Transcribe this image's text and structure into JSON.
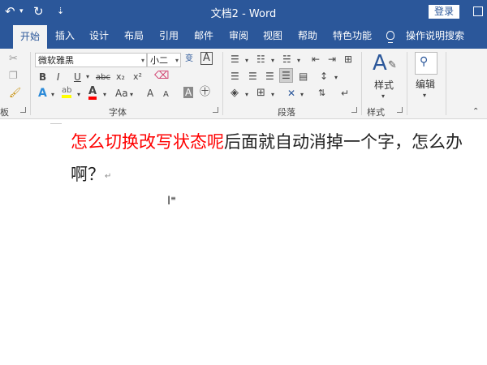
{
  "titlebar": {
    "undo_icon": "↶",
    "dropdown_arrow": "▾",
    "redo_icon": "↻",
    "customize_icon": "⇣",
    "title": "文档2 - Word",
    "login": "登录"
  },
  "tabs": [
    {
      "label": "开始",
      "active": true
    },
    {
      "label": "插入"
    },
    {
      "label": "设计"
    },
    {
      "label": "布局"
    },
    {
      "label": "引用"
    },
    {
      "label": "邮件"
    },
    {
      "label": "审阅"
    },
    {
      "label": "视图"
    },
    {
      "label": "帮助"
    },
    {
      "label": "特色功能"
    }
  ],
  "tellme": "操作说明搜索",
  "clipboard": {
    "label": "板"
  },
  "font": {
    "name": "微软雅黑",
    "size": "小二",
    "wen": "变",
    "border_a": "A",
    "bold": "B",
    "italic": "I",
    "underline": "U",
    "strike": "abc",
    "subscript": "x₂",
    "superscript": "x²",
    "grow": "A",
    "shrink": "A",
    "case": "Aa",
    "shade": "A",
    "label": "字体"
  },
  "paragraph": {
    "label": "段落"
  },
  "styles": {
    "button": "样式",
    "label": "样式"
  },
  "editing": {
    "button": "编辑"
  },
  "document": {
    "line1_red": "怎么切换改写状态呢",
    "line1_rest": "后面就自动消掉一个字，怎么办",
    "line2": "啊？",
    "para_mark": "↵"
  },
  "colors": {
    "accent": "#2b579a",
    "red_text": "#ff0000",
    "highlight": "#ffff00",
    "font_color": "#ff0000"
  }
}
